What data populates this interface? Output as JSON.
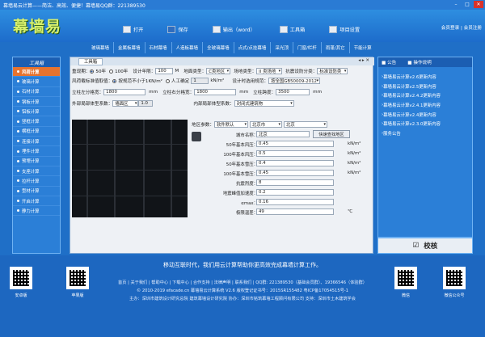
{
  "window": {
    "title": "幕墙易云计算——简洁、高效、便捷！幕墙易QQ群：221389530"
  },
  "header": {
    "logo": "幕墙易",
    "buttons": [
      {
        "label": "打开",
        "icon": "open-icon"
      },
      {
        "label": "保存",
        "icon": "save-icon"
      },
      {
        "label": "输出（word）",
        "icon": "word-icon"
      },
      {
        "label": "工具箱",
        "icon": "toolbox-icon"
      },
      {
        "label": "项目设置",
        "icon": "settings-icon"
      }
    ],
    "links": "会员登录 | 会员注册"
  },
  "nav_tabs": [
    "玻璃幕墙",
    "金属板幕墙",
    "石材幕墙",
    "人造板幕墙",
    "全玻璃幕墙",
    "点式/点挂幕墙",
    "采光顶",
    "门窗/栏杆",
    "雨蓬/其它",
    "节能计算"
  ],
  "left_panel": {
    "title": "工具箱",
    "items": [
      "风荷计算",
      "玻璃计算",
      "石材计算",
      "钢板计算",
      "铝板计算",
      "竖框计算",
      "横框计算",
      "连接计算",
      "埋件计算",
      "预埋计算",
      "支座计算",
      "拉杆计算",
      "型材计算",
      "开启计算",
      "静力计算"
    ],
    "active_index": 0
  },
  "main": {
    "tab_label": "工具箱",
    "ctl": "◂ ▸ ✕",
    "row1": {
      "l1": "重现期：",
      "o1": "50年",
      "o2": "100年",
      "l2": "设计年限：",
      "v2": "100",
      "u2": "M",
      "l3": "地面类型：",
      "v3": "C类地区",
      "l4": "场地类型：",
      "v4": "II 类场地",
      "l5": "抗震设防分类：",
      "v5": "标准设防类"
    },
    "row2": {
      "l1": "风荷载标准值取值：",
      "o1": "按规范不小于1KN/m²",
      "o2": "人工确定",
      "v2": "1",
      "u2": "kN/m²",
      "l3": "设计时选用规范：",
      "v3": "按全国GB50009-2012"
    },
    "row3": {
      "l1": "立柱左分格宽：",
      "v1": "1800",
      "u1": "mm",
      "l2": "立柱右分格宽：",
      "v2": "1800",
      "u2": "mm",
      "l3": "立柱跨度：",
      "v3": "3500",
      "u3": "mm"
    },
    "row4": {
      "l1": "外部局部体型系数：",
      "v1": "墙面区",
      "v1b": "1.0",
      "l2": "内部局部体型系数：",
      "v2": "封闭式建筑物"
    },
    "geo": {
      "label": "地区参数：",
      "province": "软件默认",
      "city1": "北京市",
      "city2": "北京"
    },
    "params": [
      {
        "label": "城市名称：",
        "value": "北京",
        "unit": "",
        "button": "快速查找地区"
      },
      {
        "label": "50年基本风压：",
        "value": "0.45",
        "unit": "kN/m²"
      },
      {
        "label": "100年基本风压：",
        "value": "0.5",
        "unit": "kN/m²"
      },
      {
        "label": "50年基本雪压：",
        "value": "0.4",
        "unit": "kN/m²"
      },
      {
        "label": "100年基本雪压：",
        "value": "0.45",
        "unit": "kN/m²"
      },
      {
        "label": "抗震烈度：",
        "value": "8",
        "unit": ""
      },
      {
        "label": "地震峰值加速度：",
        "value": "0.2",
        "unit": ""
      },
      {
        "label": "αmax：",
        "value": "0.16",
        "unit": ""
      },
      {
        "label": "极限温差：",
        "value": "49",
        "unit": "℃"
      }
    ]
  },
  "right_panel": {
    "tabs": [
      "公告",
      "操作说明"
    ],
    "items": [
      "幕墙易云计算v2.6更新内容",
      "幕墙易云计算v2.5更新内容",
      "幕墙易云计算v2.4.2更新内容",
      "幕墙易云计算v2.4.1更新内容",
      "幕墙易云计算v2.4更新内容",
      "幕墙易云计算v2.3.0更新内容",
      "服务公告"
    ]
  },
  "check_button": "校核",
  "footer": {
    "slogan": "移动互联时代，我们用云计算帮助你更高效完成幕墙计算工作。",
    "line1": "首页 | 关于我们 | 帮助中心 | 下载中心 | 合作支持 | 法律声明 | 联系我们 | QQ群: 221389530（基础会员群）、19366546（体验群）",
    "line2": "© 2010-2019 efacade.cn 幕墙易云计算系统 V2.6 版权登记证书号：2015SR155482 粤ICP备17054515号-1",
    "line3": "主办：深圳市建筑设计研究总院 建筑幕墙设计研究院 协办：深圳市铭筑幕墙工程顾问有限公司 支持：深圳市土木建筑学会",
    "qr_left1": "安卓版",
    "qr_left2": "苹果版",
    "qr_right1": "微信",
    "qr_right2": "微信公众号"
  }
}
